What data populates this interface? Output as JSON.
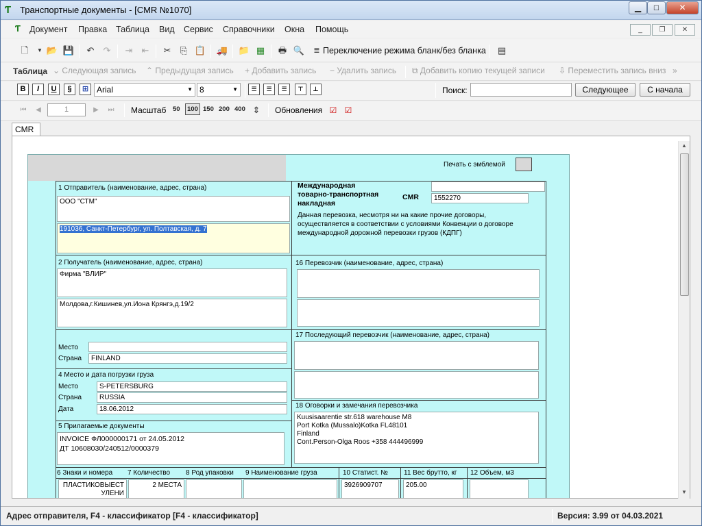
{
  "window": {
    "title": "Транспортные документы - [CMR №1070]"
  },
  "menu": [
    "Документ",
    "Правка",
    "Таблица",
    "Вид",
    "Сервис",
    "Справочники",
    "Окна",
    "Помощь"
  ],
  "toolbar": {
    "toggle_label": "Переключение режима бланк/без бланка"
  },
  "table_bar": {
    "title": "Таблица",
    "next": "Следующая запись",
    "prev": "Предыдущая запись",
    "add": "Добавить запись",
    "delete": "Удалить запись",
    "copy": "Добавить копию текущей записи",
    "move_down": "Переместить запись вниз"
  },
  "format_bar": {
    "bold": "B",
    "italic": "I",
    "underline": "U",
    "font": "Arial",
    "size": "8",
    "search_label": "Поиск:",
    "search_value": "",
    "next_btn": "Следующее",
    "restart_btn": "С начала"
  },
  "nav_bar": {
    "page": "1",
    "scale_label": "Масштаб",
    "zooms": [
      "50",
      "100",
      "150",
      "200",
      "400"
    ],
    "updates_label": "Обновления"
  },
  "tab": "CMR",
  "form": {
    "print_emblem": "Печать с эмблемой",
    "sender_label": "1 Отправитель (наименование, адрес, страна)",
    "sender_name": "ООО \"СТМ\"",
    "sender_address": "191036, Санкт-Петербург, ул. Полтавская, д. 7",
    "title_line1": "Международная",
    "title_line2": "товарно-транспортная",
    "title_line3": "накладная",
    "cmr_label": "CMR",
    "cmr_number": "1552270",
    "convention_text": "Данная перевозка, несмотря ни на какие прочие договоры,\nосуществляется в соответствии с условиями Конвенции о договоре\nмеждународной дорожной перевозки грузов (КДПГ)",
    "consignee_label": "2 Получатель (наименование, адрес, страна)",
    "consignee_name": "Фирма \"ВЛИР\"",
    "consignee_address": "Молдова,г.Кишинев,ул.Иона Крянгэ,д.19/2",
    "carrier_label": "16 Перевозчик (наименование, адрес, страна)",
    "place_label": "Место",
    "country_label": "Страна",
    "delivery_place": "",
    "delivery_country": "FINLAND",
    "next_carrier_label": "17 Последующий перевозчик (наименование, адрес, страна)",
    "loading_label": "4 Место и дата погрузки груза",
    "loading_place_label": "Место",
    "loading_country_label": "Страна",
    "loading_date_label": "Дата",
    "loading_place": "S-PETERSBURG",
    "loading_country": "RUSSIA",
    "loading_date": "18.06.2012",
    "remarks_label": "18 Оговорки и замечания перевозчика",
    "remarks_text": "Kuusisaarentie str.618 warehouse M8\nPort Kotka (Mussalo)Kotka FL48101\nFinland\nCont.Person-Olga Roos +358 444496999",
    "docs_label": "5 Прилагаемые документы",
    "docs_text": "INVOICE ФЛ000000171 от 24.05.2012\nДТ 10608030/240512/0000379",
    "col6": "6 Знаки и номера",
    "col7": "7 Количество",
    "col8": "8 Род упаковки",
    "col9": "9 Наименование груза",
    "col10": "10 Статист. №",
    "col11": "11 Вес брутто, кг",
    "col12": "12 Объем, м3",
    "row_marks": "ПЛАСТИКОВЫЕСТ\nУЛЕНИ",
    "row_qty": "2 МЕСТА",
    "row_stat": "3926909707",
    "row_weight": "205.00"
  },
  "status": {
    "left": "Адрес отправителя, F4 - классификатор [F4 - классификатор]",
    "right": "Версия: 3.99 от 04.03.2021"
  }
}
